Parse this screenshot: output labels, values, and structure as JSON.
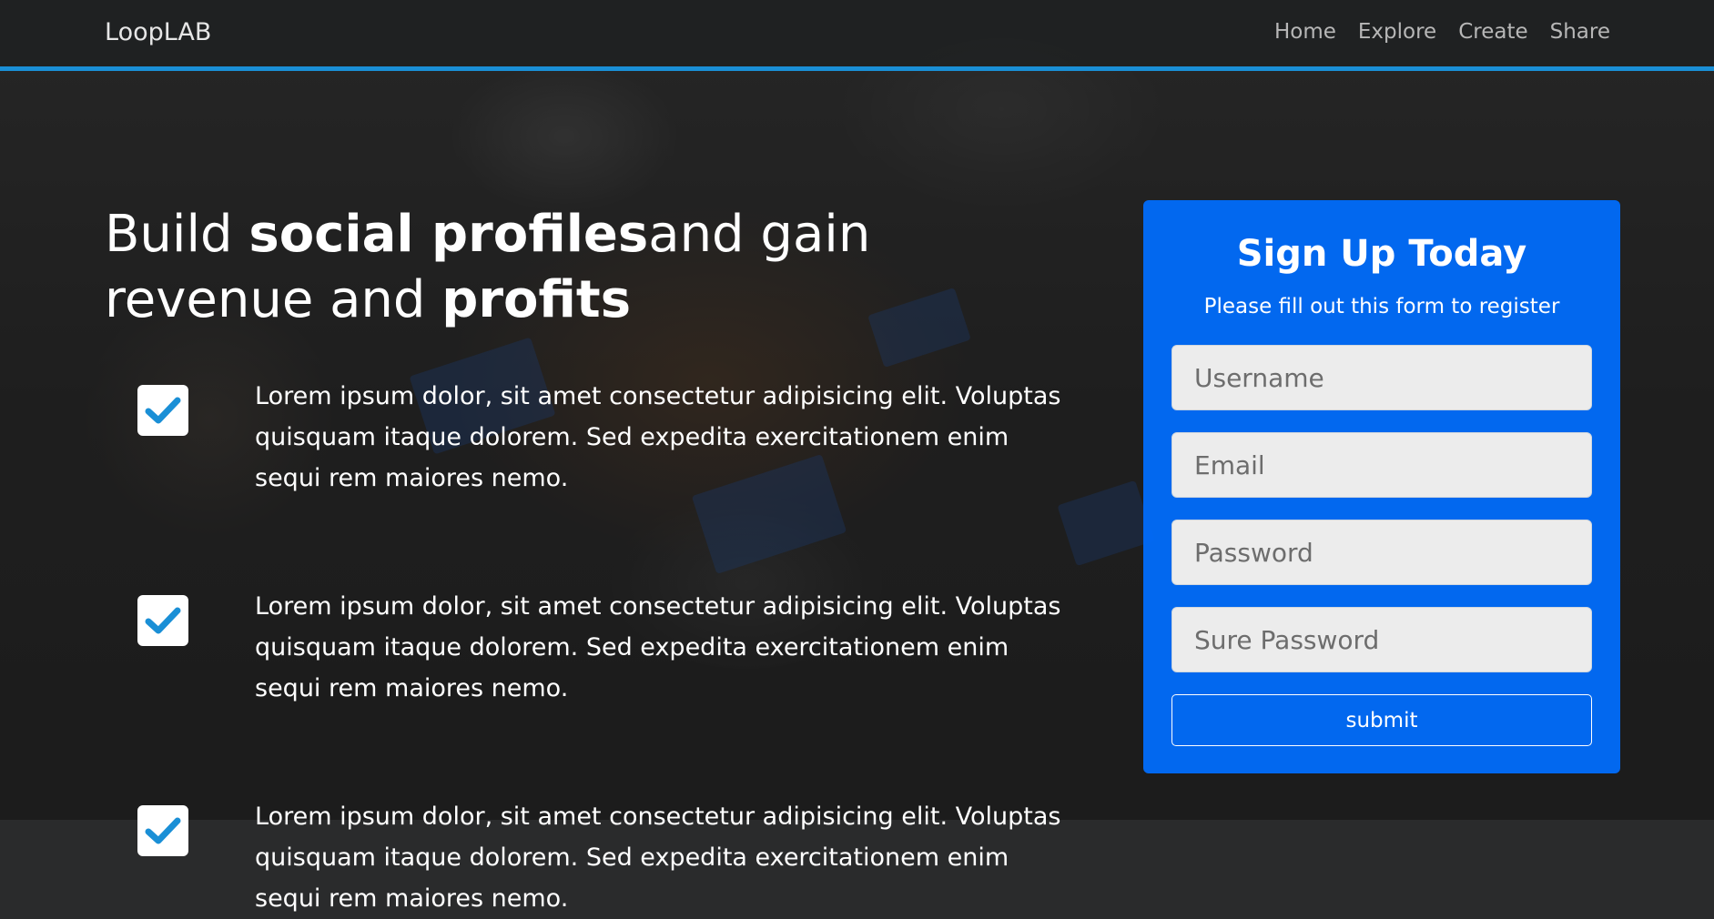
{
  "brand": "LoopLAB",
  "nav": {
    "links": [
      "Home",
      "Explore",
      "Create",
      "Share"
    ]
  },
  "hero": {
    "title_parts": [
      "Build ",
      "social profiles",
      "and gain revenue and ",
      "profits"
    ]
  },
  "features": [
    {
      "text": "Lorem ipsum dolor, sit amet consectetur adipisicing elit. Voluptas quisquam itaque dolorem. Sed expedita exercitationem enim sequi rem maiores nemo."
    },
    {
      "text": "Lorem ipsum dolor, sit amet consectetur adipisicing elit. Voluptas quisquam itaque dolorem. Sed expedita exercitationem enim sequi rem maiores nemo."
    },
    {
      "text": "Lorem ipsum dolor, sit amet consectetur adipisicing elit. Voluptas quisquam itaque dolorem. Sed expedita exercitationem enim sequi rem maiores nemo."
    }
  ],
  "signup": {
    "title": "Sign Up Today",
    "subtitle": "Please fill out this form to register",
    "fields": {
      "username": {
        "placeholder": "Username",
        "value": ""
      },
      "email": {
        "placeholder": "Email",
        "value": ""
      },
      "password": {
        "placeholder": "Password",
        "value": ""
      },
      "confirm": {
        "placeholder": "Sure Password",
        "value": ""
      }
    },
    "submit_label": "submit"
  },
  "icons": {
    "checkbox": "check-icon"
  },
  "colors": {
    "accent": "#1a8fd6",
    "form_bg": "#006eff",
    "check": "#1a8fd6"
  }
}
